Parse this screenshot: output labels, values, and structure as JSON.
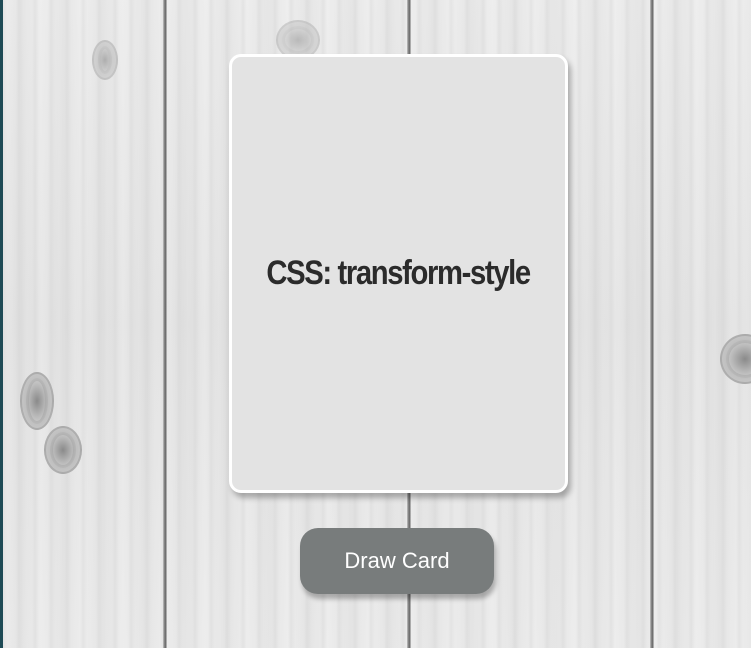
{
  "card": {
    "title": "CSS: transform-style"
  },
  "controls": {
    "draw_label": "Draw Card"
  },
  "colors": {
    "card_face": "#e3e3e3",
    "card_border": "#ffffff",
    "button_bg": "#787c7c",
    "button_text": "#ffffff",
    "background": "#ececec"
  }
}
